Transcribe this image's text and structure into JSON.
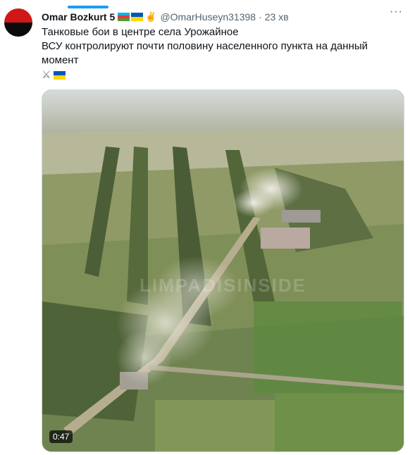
{
  "tweet": {
    "author_name": "Omar Bozkurt 5",
    "handle": "@OmarHuseyn31398",
    "separator": "·",
    "time": "23 хв",
    "more_icon": "more-dots-icon",
    "lines": [
      "Танковые бои в центре села Урожайное",
      "ВСУ контролируют почти половину населенного пункта на данный",
      "момент"
    ],
    "emoji": [
      "crossed-swords-icon",
      "ukraine-flag-icon"
    ]
  },
  "video": {
    "duration": "0:47",
    "watermark": "LIMPADISINSIDE"
  },
  "colors": {
    "accent": "#1d9bf0",
    "avatar_top": "#d01818",
    "avatar_bottom": "#0b0b0b",
    "muted": "#536471"
  }
}
